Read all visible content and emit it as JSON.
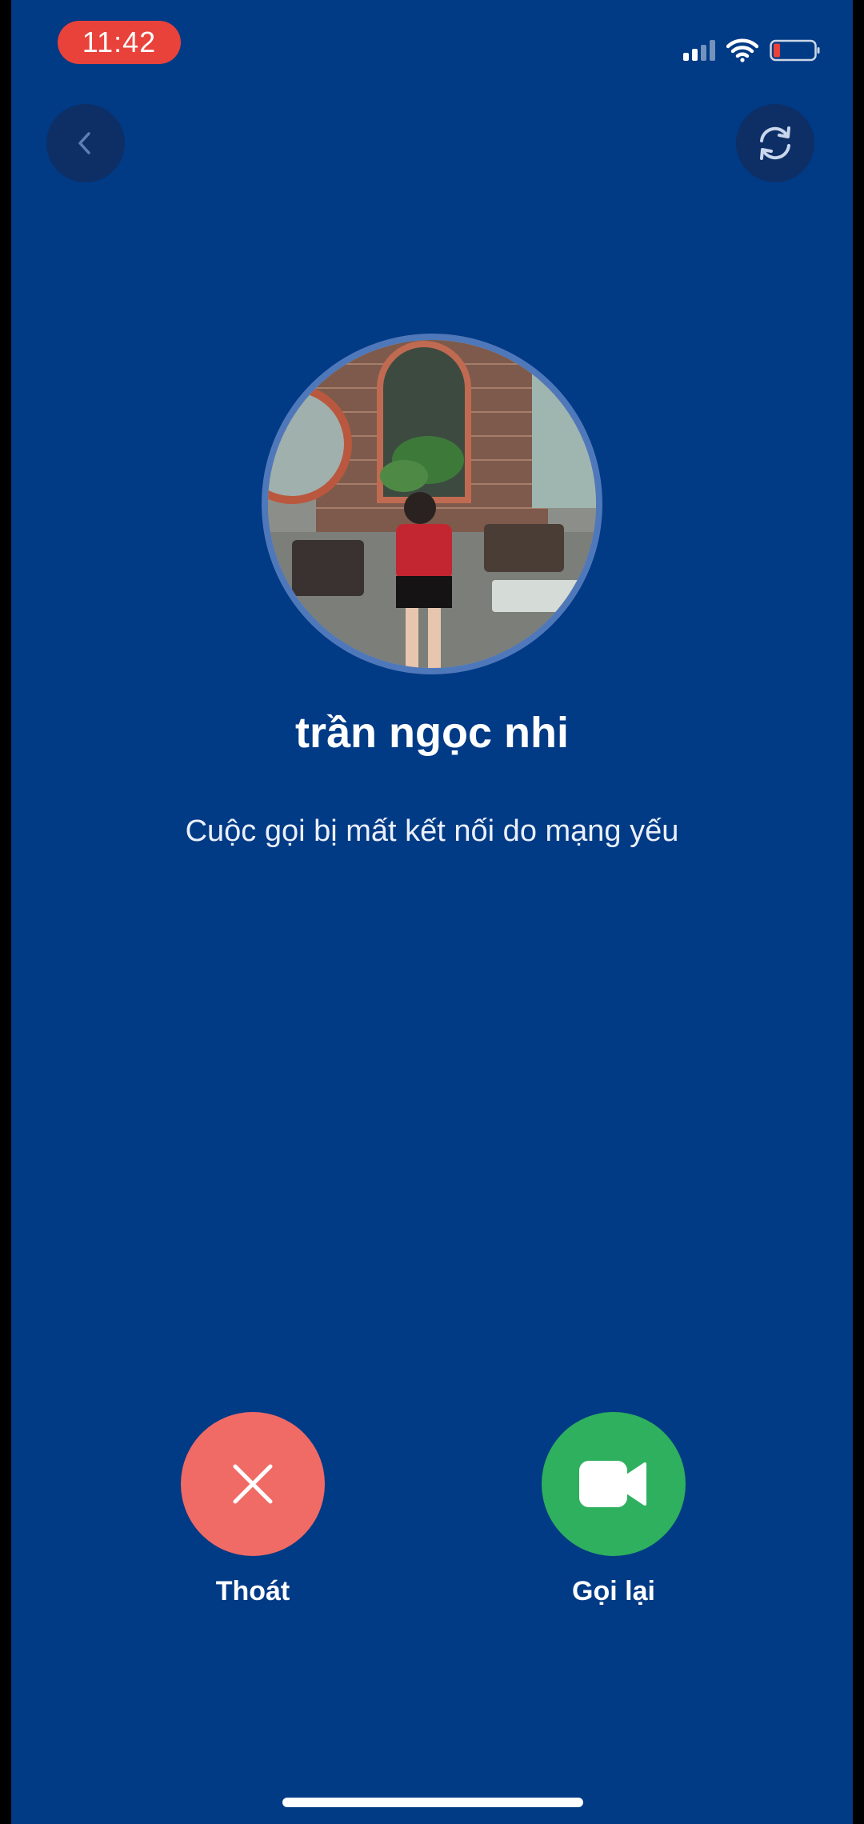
{
  "status_bar": {
    "time": "11:42"
  },
  "top_bar": {
    "back_icon": "chevron-left-icon",
    "switch_icon": "refresh-icon"
  },
  "contact": {
    "name": "trần ngọc nhi",
    "call_status": "Cuộc gọi bị mất kết nối do mạng yếu"
  },
  "actions": {
    "exit_label": "Thoát",
    "recall_label": "Gọi lại"
  },
  "colors": {
    "background": "#013a85",
    "exit": "#f06b66",
    "recall": "#2eb05e",
    "time_pill": "#e8423a"
  }
}
